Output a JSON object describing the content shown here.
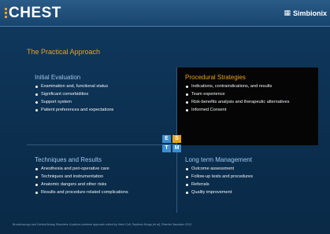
{
  "header": {
    "brand": "CHEST",
    "sponsor": "Simbionix",
    "sponsor_icon": "building-icon"
  },
  "section_title": "The Practical Approach",
  "quadrants": {
    "top_left": {
      "title": "Initial Evaluation",
      "items": [
        "Examination and, functional status",
        "Significant comorbidities",
        "Support system",
        "Patient preferences and  expectations"
      ]
    },
    "top_right": {
      "title": "Procedural Strategies",
      "items": [
        "Indications, contraindications, and results",
        "Team experience",
        "Risk-benefits analysis and therapeutic alternatives",
        "Informed Consent"
      ]
    },
    "bottom_left": {
      "title": "Techniques and Results",
      "items": [
        "Anesthesia and peri-operative care",
        "Techniques and instrumentation",
        "Anatomic dangers and other risks",
        "Results and procedure-related complications"
      ]
    },
    "bottom_right": {
      "title": "Long term Management",
      "items": [
        "Outcome assessment",
        "Follow-up tests and procedures",
        "Referrals",
        "Quality improvement"
      ]
    }
  },
  "badges": {
    "e": "E",
    "s": "S",
    "t": "T",
    "m": "M"
  },
  "colors": {
    "accent": "#e9a21f",
    "heading_blue": "#9cc6ec",
    "background": "#0d2f4f",
    "highlight_panel": "#050505",
    "badge_blue": "#3b8ed1"
  },
  "footer": "Bronchoscopy and Central Airway Disorders: A patient-centered approach edited by Henri Colt, Septimiu Murgu (et al), Elsevier Saunders 2012"
}
